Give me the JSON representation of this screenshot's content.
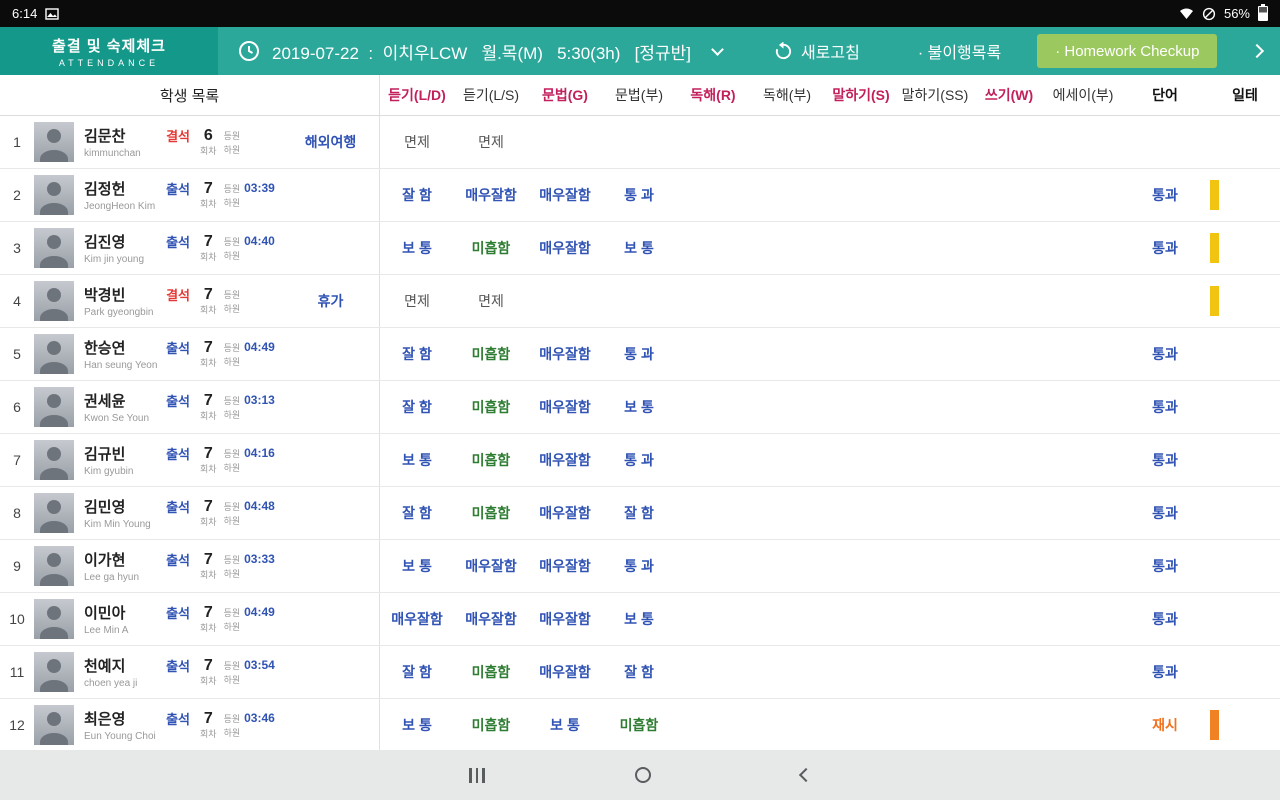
{
  "status_bar": {
    "time": "6:14",
    "battery": "56%"
  },
  "header": {
    "app_title": "출결 및 숙제체크",
    "app_subtitle": "ATTENDANCE",
    "session_info": "2019-07-22  :  이치우LCW   월.목(M)   5:30(3h)   [정규반]",
    "refresh_label": "새로고침",
    "noncompliance_label": "· 불이행목록",
    "homework_button_label": "· Homework Checkup"
  },
  "colors": {
    "accent_teal": "#2ba89a",
    "title_block_teal": "#13988a",
    "homework_button_green": "#9bc95f",
    "grade_blue": "#3053b4",
    "grade_green": "#2e7d32",
    "grade_orange": "#f2711c",
    "absent_red": "#e53935",
    "bar_yellow": "#f1c411",
    "bar_orange": "#f08224",
    "column_pink": "#c21f5b"
  },
  "table": {
    "list_title": "학생 목록",
    "labels": {
      "session": "회차",
      "arrive": "등원",
      "leave": "하원"
    },
    "columns": [
      {
        "label": "듣기(L/D)",
        "style": "pink"
      },
      {
        "label": "듣기(L/S)",
        "style": "plain"
      },
      {
        "label": "문법(G)",
        "style": "pink"
      },
      {
        "label": "문법(부)",
        "style": "plain"
      },
      {
        "label": "독해(R)",
        "style": "pink"
      },
      {
        "label": "독해(부)",
        "style": "plain"
      },
      {
        "label": "말하기(S)",
        "style": "pink"
      },
      {
        "label": "말하기(SS)",
        "style": "plain"
      },
      {
        "label": "쓰기(W)",
        "style": "pink"
      },
      {
        "label": "에세이(부)",
        "style": "plain"
      },
      {
        "label": "단어",
        "style": "dark"
      },
      {
        "label": "일테",
        "style": "dark"
      }
    ],
    "rows": [
      {
        "no": "1",
        "name": "김문찬",
        "roman": "kimmunchan",
        "status": "결석",
        "status_type": "absent",
        "sessions": "6",
        "arrive_time": "",
        "note": "해외여행",
        "grades": [
          {
            "t": "면제",
            "c": "gray"
          },
          {
            "t": "면제",
            "c": "gray"
          }
        ],
        "word": {
          "t": "",
          "c": ""
        },
        "bar": ""
      },
      {
        "no": "2",
        "name": "김정헌",
        "roman": "JeongHeon Kim",
        "status": "출석",
        "status_type": "present",
        "sessions": "7",
        "arrive_time": "03:39",
        "note": "",
        "grades": [
          {
            "t": "잘 함",
            "c": "blue"
          },
          {
            "t": "매우잘함",
            "c": "blue"
          },
          {
            "t": "매우잘함",
            "c": "blue"
          },
          {
            "t": "통 과",
            "c": "blue"
          }
        ],
        "word": {
          "t": "통과",
          "c": "blue"
        },
        "bar": "yellow"
      },
      {
        "no": "3",
        "name": "김진영",
        "roman": "Kim jin young",
        "status": "출석",
        "status_type": "present",
        "sessions": "7",
        "arrive_time": "04:40",
        "note": "",
        "grades": [
          {
            "t": "보 통",
            "c": "blue"
          },
          {
            "t": "미흡함",
            "c": "green"
          },
          {
            "t": "매우잘함",
            "c": "blue"
          },
          {
            "t": "보 통",
            "c": "blue"
          }
        ],
        "word": {
          "t": "통과",
          "c": "blue"
        },
        "bar": "yellow"
      },
      {
        "no": "4",
        "name": "박경빈",
        "roman": "Park gyeongbin",
        "status": "결석",
        "status_type": "absent",
        "sessions": "7",
        "arrive_time": "",
        "note": "휴가",
        "grades": [
          {
            "t": "면제",
            "c": "gray"
          },
          {
            "t": "면제",
            "c": "gray"
          }
        ],
        "word": {
          "t": "",
          "c": ""
        },
        "bar": "yellow"
      },
      {
        "no": "5",
        "name": "한승연",
        "roman": "Han seung Yeon",
        "status": "출석",
        "status_type": "present",
        "sessions": "7",
        "arrive_time": "04:49",
        "note": "",
        "grades": [
          {
            "t": "잘 함",
            "c": "blue"
          },
          {
            "t": "미흡함",
            "c": "green"
          },
          {
            "t": "매우잘함",
            "c": "blue"
          },
          {
            "t": "통 과",
            "c": "blue"
          }
        ],
        "word": {
          "t": "통과",
          "c": "blue"
        },
        "bar": ""
      },
      {
        "no": "6",
        "name": "권세윤",
        "roman": "Kwon Se Youn",
        "status": "출석",
        "status_type": "present",
        "sessions": "7",
        "arrive_time": "03:13",
        "note": "",
        "grades": [
          {
            "t": "잘 함",
            "c": "blue"
          },
          {
            "t": "미흡함",
            "c": "green"
          },
          {
            "t": "매우잘함",
            "c": "blue"
          },
          {
            "t": "보 통",
            "c": "blue"
          }
        ],
        "word": {
          "t": "통과",
          "c": "blue"
        },
        "bar": ""
      },
      {
        "no": "7",
        "name": "김규빈",
        "roman": "Kim gyubin",
        "status": "출석",
        "status_type": "present",
        "sessions": "7",
        "arrive_time": "04:16",
        "note": "",
        "grades": [
          {
            "t": "보 통",
            "c": "blue"
          },
          {
            "t": "미흡함",
            "c": "green"
          },
          {
            "t": "매우잘함",
            "c": "blue"
          },
          {
            "t": "통 과",
            "c": "blue"
          }
        ],
        "word": {
          "t": "통과",
          "c": "blue"
        },
        "bar": ""
      },
      {
        "no": "8",
        "name": "김민영",
        "roman": "Kim Min Young",
        "status": "출석",
        "status_type": "present",
        "sessions": "7",
        "arrive_time": "04:48",
        "note": "",
        "grades": [
          {
            "t": "잘 함",
            "c": "blue"
          },
          {
            "t": "미흡함",
            "c": "green"
          },
          {
            "t": "매우잘함",
            "c": "blue"
          },
          {
            "t": "잘 함",
            "c": "blue"
          }
        ],
        "word": {
          "t": "통과",
          "c": "blue"
        },
        "bar": ""
      },
      {
        "no": "9",
        "name": "이가현",
        "roman": "Lee ga hyun",
        "status": "출석",
        "status_type": "present",
        "sessions": "7",
        "arrive_time": "03:33",
        "note": "",
        "grades": [
          {
            "t": "보 통",
            "c": "blue"
          },
          {
            "t": "매우잘함",
            "c": "blue"
          },
          {
            "t": "매우잘함",
            "c": "blue"
          },
          {
            "t": "통 과",
            "c": "blue"
          }
        ],
        "word": {
          "t": "통과",
          "c": "blue"
        },
        "bar": ""
      },
      {
        "no": "10",
        "name": "이민아",
        "roman": "Lee Min A",
        "status": "출석",
        "status_type": "present",
        "sessions": "7",
        "arrive_time": "04:49",
        "note": "",
        "grades": [
          {
            "t": "매우잘함",
            "c": "blue"
          },
          {
            "t": "매우잘함",
            "c": "blue"
          },
          {
            "t": "매우잘함",
            "c": "blue"
          },
          {
            "t": "보 통",
            "c": "blue"
          }
        ],
        "word": {
          "t": "통과",
          "c": "blue"
        },
        "bar": ""
      },
      {
        "no": "11",
        "name": "천예지",
        "roman": "choen yea ji",
        "status": "출석",
        "status_type": "present",
        "sessions": "7",
        "arrive_time": "03:54",
        "note": "",
        "grades": [
          {
            "t": "잘 함",
            "c": "blue"
          },
          {
            "t": "미흡함",
            "c": "green"
          },
          {
            "t": "매우잘함",
            "c": "blue"
          },
          {
            "t": "잘 함",
            "c": "blue"
          }
        ],
        "word": {
          "t": "통과",
          "c": "blue"
        },
        "bar": ""
      },
      {
        "no": "12",
        "name": "최은영",
        "roman": "Eun Young Choi",
        "status": "출석",
        "status_type": "present",
        "sessions": "7",
        "arrive_time": "03:46",
        "note": "",
        "grades": [
          {
            "t": "보 통",
            "c": "blue"
          },
          {
            "t": "미흡함",
            "c": "green"
          },
          {
            "t": "보 통",
            "c": "blue"
          },
          {
            "t": "미흡함",
            "c": "green"
          }
        ],
        "word": {
          "t": "재시",
          "c": "orange"
        },
        "bar": "orange"
      }
    ]
  },
  "nav": {
    "icons": [
      "recents",
      "home",
      "back"
    ]
  }
}
